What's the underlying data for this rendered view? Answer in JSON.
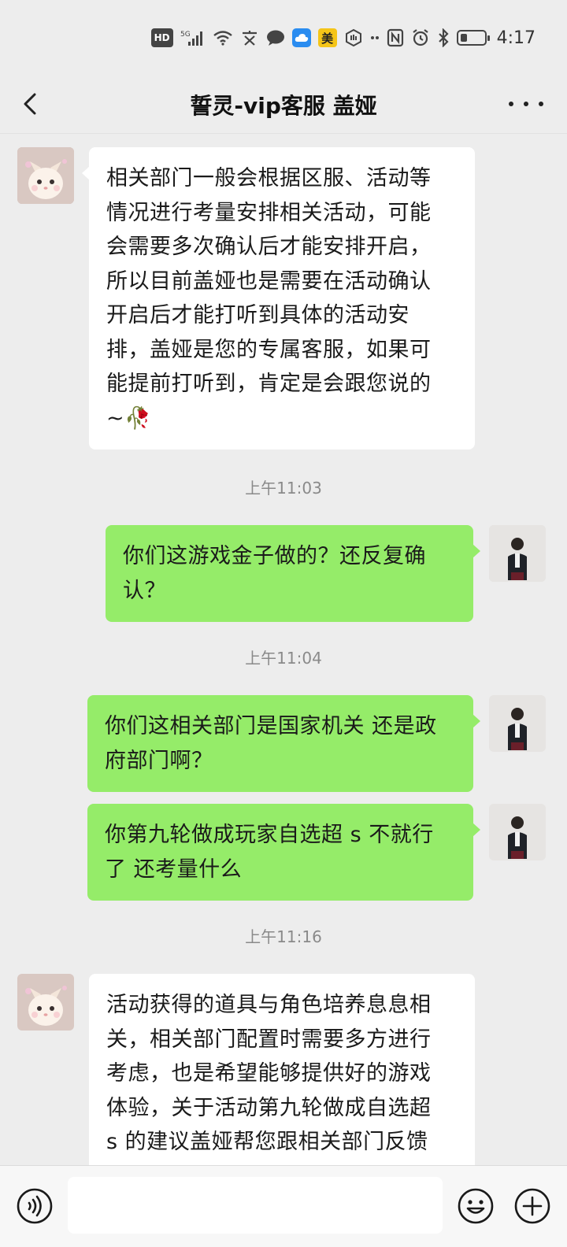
{
  "status_bar": {
    "hd": "HD",
    "network": "5G",
    "mei": "美",
    "time": "4:17"
  },
  "header": {
    "title": "誓灵-vip客服 盖娅"
  },
  "messages": [
    {
      "direction": "in",
      "lines": [
        "相关部门一般会根据区服、活动等",
        "情况进行考量安排相关活动，可能",
        "会需要多次确认后才能安排开启，",
        "所以目前盖娅也是需要在活动确认",
        "开启后才能打听到具体的活动安",
        "排，盖娅是您的专属客服，如果可",
        "能提前打听到，肯定是会跟您说的",
        "~🥀"
      ]
    },
    {
      "time": "上午11:03"
    },
    {
      "direction": "out",
      "lines": [
        "你们这游戏金子做的？还反复确",
        "认？"
      ]
    },
    {
      "time": "上午11:04"
    },
    {
      "direction": "out",
      "lines": [
        "你们这相关部门是国家机关 还是政",
        "府部门啊？"
      ]
    },
    {
      "direction": "out",
      "lines": [
        "你第九轮做成玩家自选超 s 不就行",
        "了 还考量什么"
      ]
    },
    {
      "time": "上午11:16"
    },
    {
      "direction": "in",
      "lines": [
        "活动获得的道具与角色培养息息相",
        "关，相关部门配置时需要多方进行",
        "考虑，也是希望能够提供好的游戏",
        "体验，关于活动第九轮做成自选超",
        "s 的建议盖娅帮您跟相关部门反馈"
      ]
    }
  ],
  "colors": {
    "background": "#ededed",
    "outgoing_bubble": "#95ec69",
    "incoming_bubble": "#ffffff"
  },
  "input_bar": {
    "placeholder": "",
    "icons": [
      "voice-icon",
      "emoji-icon",
      "plus-icon"
    ]
  }
}
